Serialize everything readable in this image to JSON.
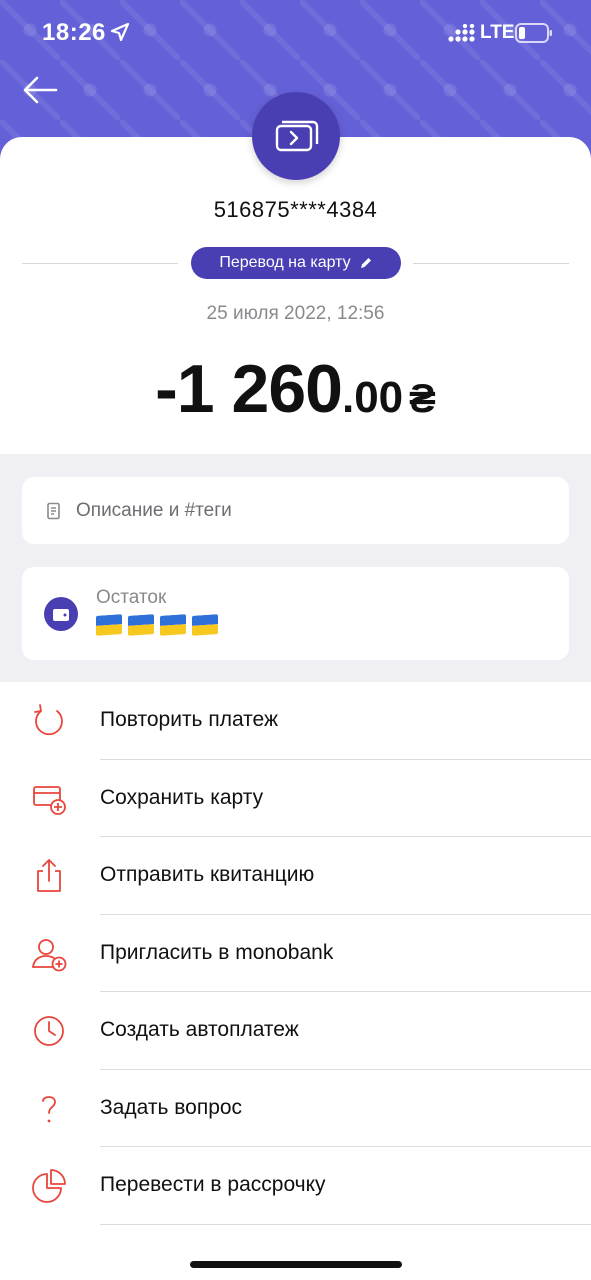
{
  "status_bar": {
    "time": "18:26",
    "network": "LTE"
  },
  "transaction": {
    "card_number": "516875****4384",
    "category": "Перевод на карту",
    "date": "25 июля 2022, 12:56",
    "amount_main": "-1 260",
    "amount_decimal": ".00",
    "currency": "₴"
  },
  "description": {
    "placeholder": "Описание и #теги"
  },
  "balance": {
    "label": "Остаток",
    "flags_count": 4
  },
  "actions": [
    {
      "label": "Повторить платеж",
      "icon": "repeat-icon"
    },
    {
      "label": "Сохранить карту",
      "icon": "card-add-icon"
    },
    {
      "label": "Отправить квитанцию",
      "icon": "share-icon"
    },
    {
      "label": "Пригласить в monobank",
      "icon": "user-add-icon"
    },
    {
      "label": "Создать автоплатеж",
      "icon": "clock-icon"
    },
    {
      "label": "Задать вопрос",
      "icon": "question-icon"
    },
    {
      "label": "Перевести в рассрочку",
      "icon": "pie-chart-icon"
    }
  ],
  "colors": {
    "header": "#6461d8",
    "accent": "#4a3eb3",
    "action_icon": "#e8453c"
  }
}
